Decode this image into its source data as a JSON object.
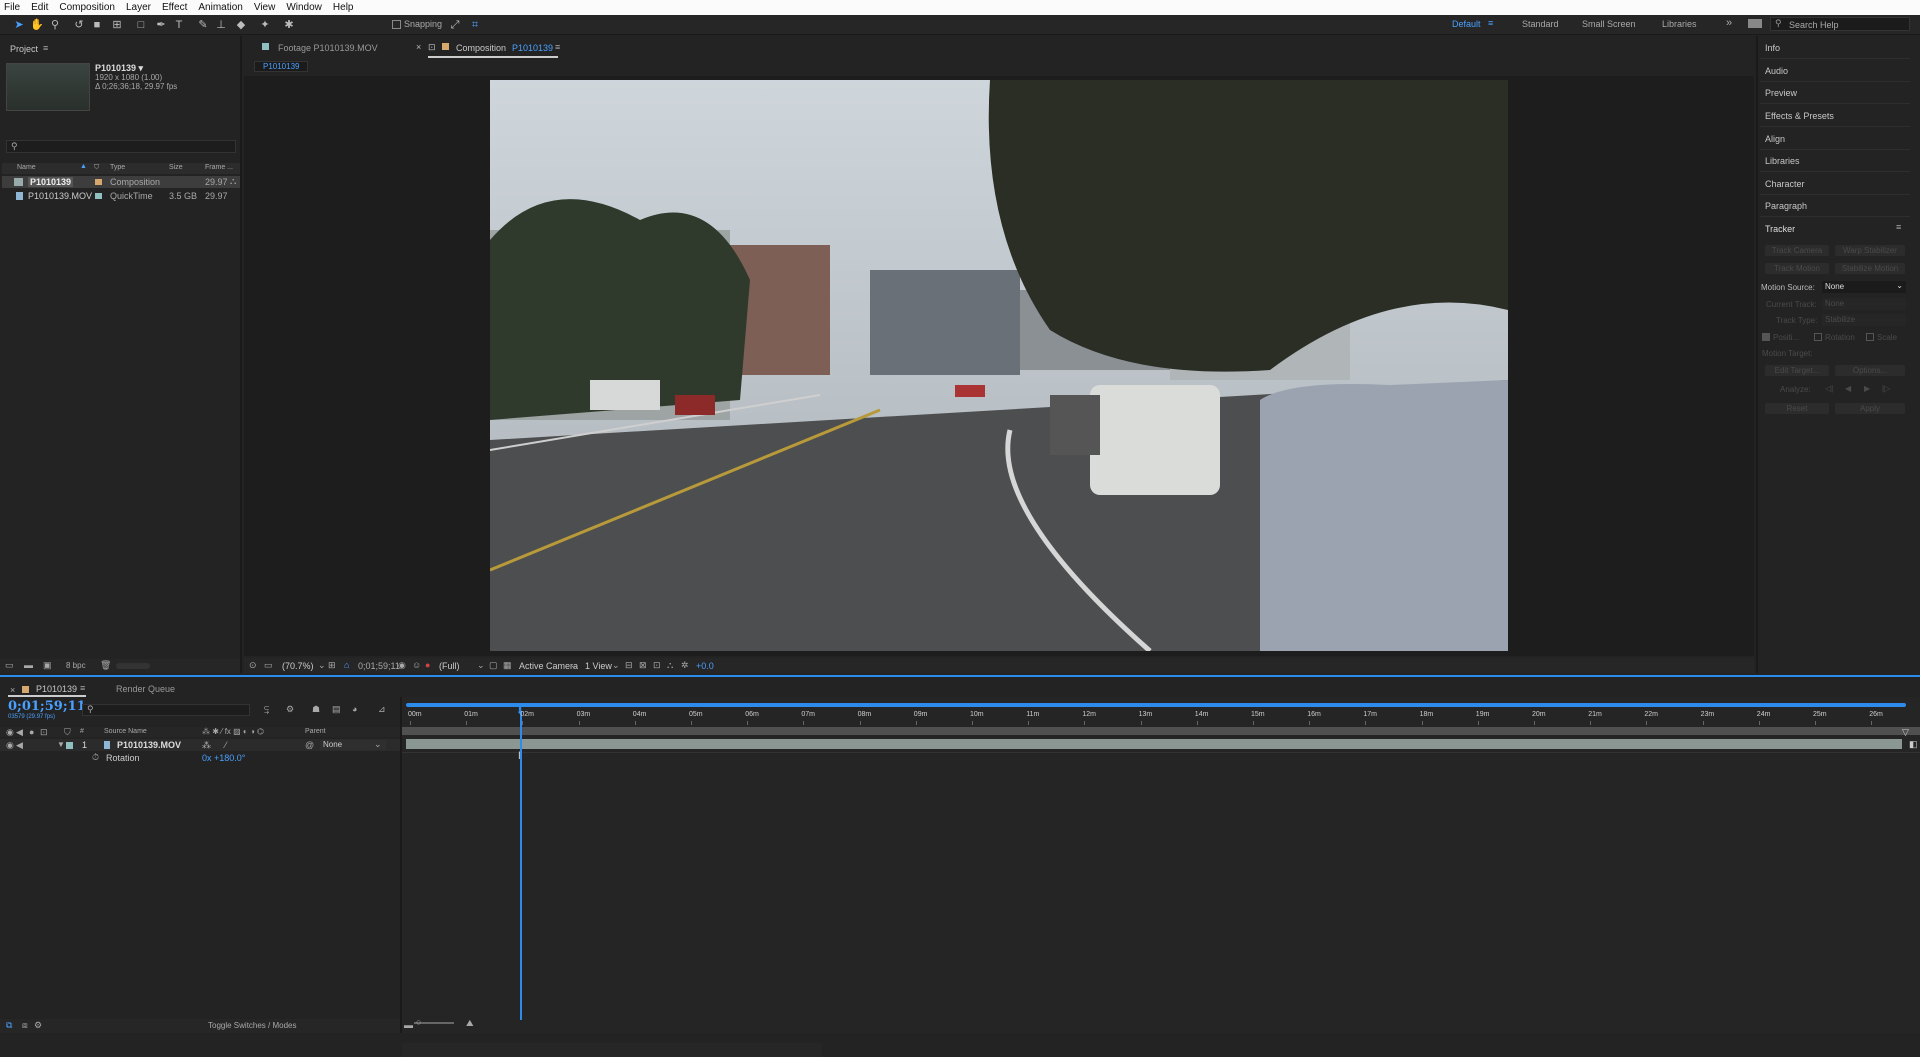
{
  "menu": [
    "File",
    "Edit",
    "Composition",
    "Layer",
    "Effect",
    "Animation",
    "View",
    "Window",
    "Help"
  ],
  "toolbar": {
    "snapping": "Snapping",
    "workspaces": [
      "Default",
      "Standard",
      "Small Screen",
      "Libraries"
    ],
    "search_placeholder": "Search Help"
  },
  "project": {
    "tab": "Project",
    "comp_name": "P1010139 ▾",
    "comp_res": "1920 x 1080 (1.00)",
    "comp_dur": "Δ 0;26;36;18, 29.97 fps",
    "columns": [
      "Name",
      "Type",
      "Size",
      "Frame ..."
    ],
    "items": [
      {
        "name": "P1010139",
        "type": "Composition",
        "size": "",
        "fps": "29.97"
      },
      {
        "name": "P1010139.MOV",
        "type": "QuickTime",
        "size": "3.5 GB",
        "fps": "29.97"
      }
    ],
    "bpc": "8 bpc"
  },
  "viewer": {
    "tab_footage": "Footage P1010139.MOV",
    "tab_comp_prefix": "Composition",
    "tab_comp_name": "P1010139",
    "flow": "P1010139",
    "zoom": "(70.7%)",
    "timecode": "0;01;59;11",
    "resolution": "(Full)",
    "camera": "Active Camera",
    "views": "1 View",
    "exposure": "+0.0"
  },
  "right_panel": {
    "items": [
      "Info",
      "Audio",
      "Preview",
      "Effects & Presets",
      "Align",
      "Libraries",
      "Character",
      "Paragraph",
      "Tracker"
    ],
    "tracker": {
      "track_camera": "Track Camera",
      "warp_stabilizer": "Warp Stabilizer",
      "track_motion": "Track Motion",
      "stabilize_motion": "Stabilize Motion",
      "motion_source_label": "Motion Source:",
      "motion_source": "None",
      "current_track_label": "Current Track:",
      "current_track": "None",
      "track_type_label": "Track Type:",
      "track_type": "Stabilize",
      "position": "Positi...",
      "rotation": "Rotation",
      "scale": "Scale",
      "motion_target": "Motion Target:",
      "edit_target": "Edit Target...",
      "options": "Options...",
      "analyze": "Analyze:",
      "reset": "Reset",
      "apply": "Apply"
    }
  },
  "timeline": {
    "tab": "P1010139",
    "render_queue": "Render Queue",
    "timecode": "0;01;59;11",
    "fps_sub": "03579 (29.97 fps)",
    "source_name": "Source Name",
    "parent": "Parent",
    "layer": {
      "num": "1",
      "name": "P1010139.MOV",
      "parent": "None"
    },
    "prop": {
      "name": "Rotation",
      "value": "0x +180.0°"
    },
    "ruler": [
      "00m",
      "01m",
      "02m",
      "03m",
      "04m",
      "05m",
      "06m",
      "07m",
      "08m",
      "09m",
      "10m",
      "11m",
      "12m",
      "13m",
      "14m",
      "15m",
      "16m",
      "17m",
      "18m",
      "19m",
      "20m",
      "21m",
      "22m",
      "23m",
      "24m",
      "25m",
      "26m"
    ],
    "toggle": "Toggle Switches / Modes",
    "playhead_fraction": 0.0753
  },
  "colors": {
    "accent": "#2d8ceb",
    "comp_label": "#d7a86e",
    "footage_label": "#8fbfbf",
    "bar": "#8a9793"
  }
}
